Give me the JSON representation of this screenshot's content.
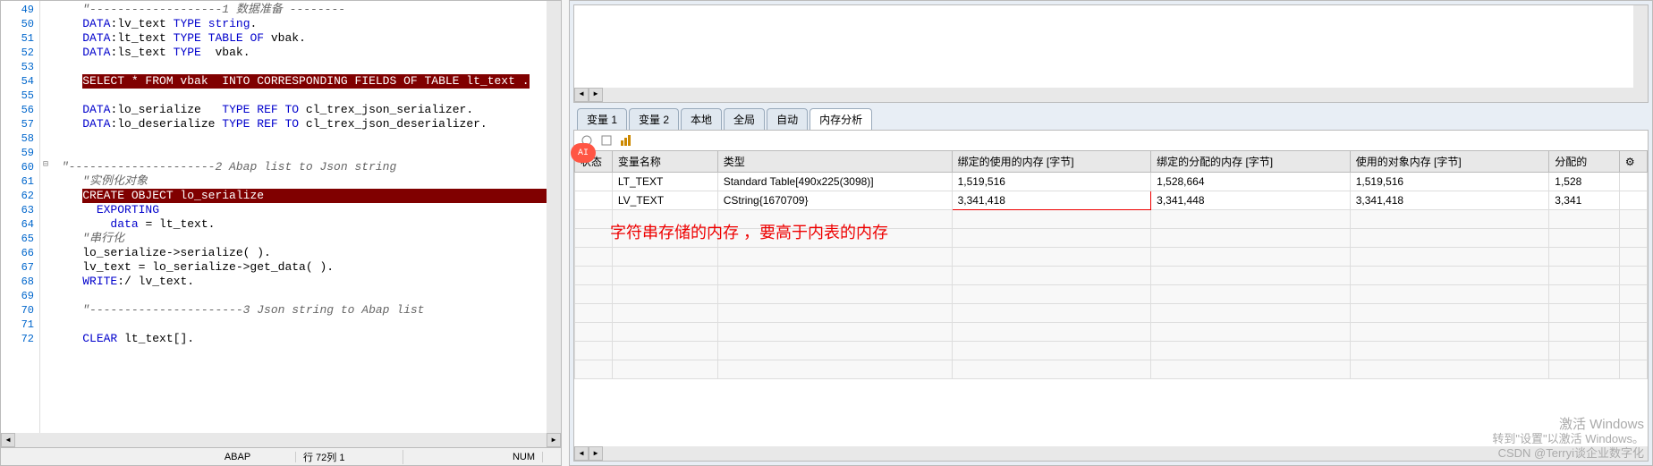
{
  "editor": {
    "lines": [
      {
        "n": 49,
        "fold": "",
        "parts": [
          {
            "t": "    ",
            "c": ""
          },
          {
            "t": "\"-------------------1 数据准备 --------",
            "c": "cm"
          }
        ]
      },
      {
        "n": 50,
        "fold": "",
        "parts": [
          {
            "t": "    ",
            "c": ""
          },
          {
            "t": "DATA",
            "c": "kw"
          },
          {
            "t": ":lv_text ",
            "c": ""
          },
          {
            "t": "TYPE",
            "c": "kw"
          },
          {
            "t": " ",
            "c": ""
          },
          {
            "t": "string",
            "c": "kw"
          },
          {
            "t": ".",
            "c": ""
          }
        ]
      },
      {
        "n": 51,
        "fold": "",
        "parts": [
          {
            "t": "    ",
            "c": ""
          },
          {
            "t": "DATA",
            "c": "kw"
          },
          {
            "t": ":lt_text ",
            "c": ""
          },
          {
            "t": "TYPE TABLE OF",
            "c": "kw"
          },
          {
            "t": " vbak",
            "c": ""
          },
          {
            "t": ".",
            "c": ""
          }
        ]
      },
      {
        "n": 52,
        "fold": "",
        "parts": [
          {
            "t": "    ",
            "c": ""
          },
          {
            "t": "DATA",
            "c": "kw"
          },
          {
            "t": ":ls_text ",
            "c": ""
          },
          {
            "t": "TYPE",
            "c": "kw"
          },
          {
            "t": "  vbak",
            "c": ""
          },
          {
            "t": ".",
            "c": ""
          }
        ]
      },
      {
        "n": 53,
        "fold": "",
        "parts": []
      },
      {
        "n": 54,
        "fold": "",
        "parts": [
          {
            "t": "    ",
            "c": ""
          },
          {
            "t": "SELECT * FROM vbak  INTO CORRESPONDING FIELDS OF TABLE lt_text .",
            "c": "hl"
          }
        ]
      },
      {
        "n": 55,
        "fold": "",
        "parts": []
      },
      {
        "n": 56,
        "fold": "",
        "parts": [
          {
            "t": "    ",
            "c": ""
          },
          {
            "t": "DATA",
            "c": "kw"
          },
          {
            "t": ":lo_serialize   ",
            "c": ""
          },
          {
            "t": "TYPE REF TO",
            "c": "kw"
          },
          {
            "t": " cl_trex_json_serializer.",
            "c": ""
          }
        ]
      },
      {
        "n": 57,
        "fold": "",
        "parts": [
          {
            "t": "    ",
            "c": ""
          },
          {
            "t": "DATA",
            "c": "kw"
          },
          {
            "t": ":lo_deserialize ",
            "c": ""
          },
          {
            "t": "TYPE REF TO",
            "c": "kw"
          },
          {
            "t": " cl_trex_json_deserializer.",
            "c": ""
          }
        ]
      },
      {
        "n": 58,
        "fold": "",
        "parts": []
      },
      {
        "n": 59,
        "fold": "",
        "parts": []
      },
      {
        "n": 60,
        "fold": "⊟",
        "parts": [
          {
            "t": " ",
            "c": ""
          },
          {
            "t": "\"---------------------2 Abap list to Json string",
            "c": "cm"
          }
        ]
      },
      {
        "n": 61,
        "fold": "",
        "parts": [
          {
            "t": "    ",
            "c": ""
          },
          {
            "t": "\"实例化对象",
            "c": "cm"
          }
        ]
      },
      {
        "n": 62,
        "fold": "",
        "parts": [
          {
            "t": "    ",
            "c": ""
          },
          {
            "t": "CREATE OBJECT lo_serialize                                             ",
            "c": "hl"
          }
        ]
      },
      {
        "n": 63,
        "fold": "",
        "parts": [
          {
            "t": "      ",
            "c": ""
          },
          {
            "t": "EXPORTING",
            "c": "kw"
          }
        ]
      },
      {
        "n": 64,
        "fold": "",
        "parts": [
          {
            "t": "        ",
            "c": ""
          },
          {
            "t": "data",
            "c": "kw"
          },
          {
            "t": " = lt_text.",
            "c": ""
          }
        ]
      },
      {
        "n": 65,
        "fold": "",
        "parts": [
          {
            "t": "    ",
            "c": ""
          },
          {
            "t": "\"串行化",
            "c": "cm"
          }
        ]
      },
      {
        "n": 66,
        "fold": "",
        "parts": [
          {
            "t": "    lo_serialize->serialize( ).",
            "c": ""
          }
        ]
      },
      {
        "n": 67,
        "fold": "",
        "parts": [
          {
            "t": "    lv_text = lo_serialize->get_data( ).",
            "c": ""
          }
        ]
      },
      {
        "n": 68,
        "fold": "",
        "parts": [
          {
            "t": "    ",
            "c": ""
          },
          {
            "t": "WRITE",
            "c": "kw"
          },
          {
            "t": ":/ lv_text.",
            "c": ""
          }
        ]
      },
      {
        "n": 69,
        "fold": "",
        "parts": []
      },
      {
        "n": 70,
        "fold": "",
        "parts": [
          {
            "t": "    ",
            "c": ""
          },
          {
            "t": "\"----------------------3 Json string to Abap list",
            "c": "cm"
          }
        ]
      },
      {
        "n": 71,
        "fold": "",
        "parts": []
      },
      {
        "n": 72,
        "fold": "",
        "parts": [
          {
            "t": "    ",
            "c": ""
          },
          {
            "t": "CLEAR",
            "c": "kw"
          },
          {
            "t": " lt_text[].",
            "c": ""
          }
        ]
      }
    ]
  },
  "status": {
    "lang": "ABAP",
    "pos": "行 72列 1",
    "mode": "NUM"
  },
  "tabs": {
    "items": [
      "变量 1",
      "变量 2",
      "本地",
      "全局",
      "自动",
      "内存分析"
    ],
    "active": 5
  },
  "table": {
    "headers": [
      "状态",
      "变量名称",
      "类型",
      "绑定的使用的内存 [字节]",
      "绑定的分配的内存 [字节]",
      "使用的对象内存 [字节]",
      "分配的"
    ],
    "rows": [
      {
        "name": "LT_TEXT",
        "type": "Standard Table[490x225(3098)]",
        "used": "1,519,516",
        "alloc": "1,528,664",
        "objused": "1,519,516",
        "objalloc": "1,528"
      },
      {
        "name": "LV_TEXT",
        "type": "CString{1670709}",
        "used": "3,341,418",
        "alloc": "3,341,448",
        "objused": "3,341,418",
        "objalloc": "3,341"
      }
    ]
  },
  "annotation": "字符串存储的内存 ，要高于内表的内存",
  "watermark": {
    "line1": "激活 Windows",
    "line2": "转到\"设置\"以激活 Windows。",
    "line3": "CSDN @Terryi谈企业数字化"
  },
  "ai_badge": "AI"
}
